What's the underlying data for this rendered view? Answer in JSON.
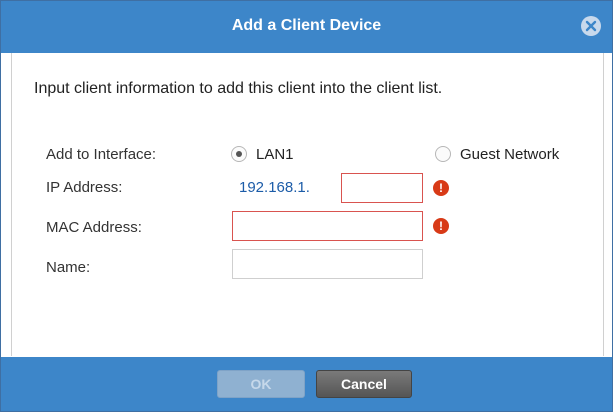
{
  "dialog": {
    "title": "Add a Client Device",
    "close_icon": "close-circle-icon",
    "instruction": "Input client information to add this client into the client list."
  },
  "form": {
    "interface": {
      "label": "Add to Interface:",
      "options": [
        {
          "label": "LAN1",
          "selected": true
        },
        {
          "label": "Guest Network",
          "selected": false
        }
      ]
    },
    "ip": {
      "label": "IP Address:",
      "prefix": "192.168.1.",
      "value": "",
      "error_icon": "!"
    },
    "mac": {
      "label": "MAC Address:",
      "value": "",
      "error_icon": "!"
    },
    "name": {
      "label": "Name:",
      "value": ""
    }
  },
  "buttons": {
    "ok": "OK",
    "cancel": "Cancel"
  },
  "colors": {
    "accent": "#3d86c9",
    "error": "#d83a17",
    "ip_prefix": "#1c5ca8"
  }
}
